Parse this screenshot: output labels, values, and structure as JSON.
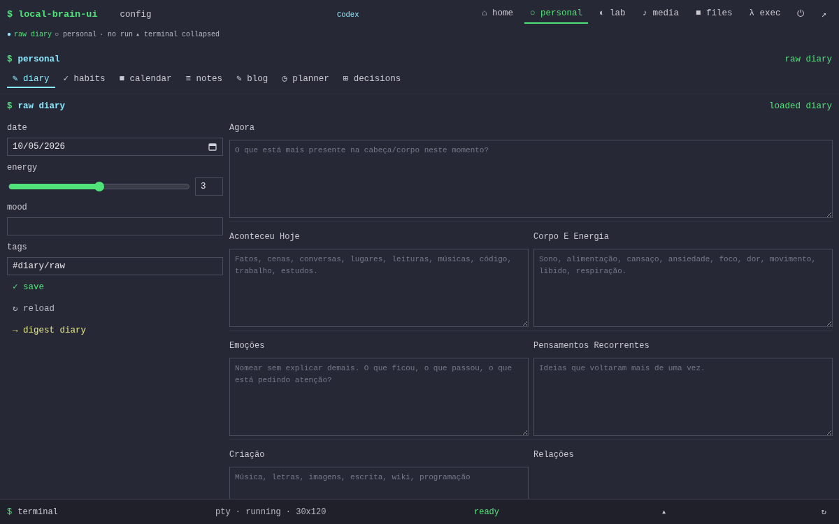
{
  "app": {
    "prompt": "$",
    "title": "local-brain-ui",
    "config": "config",
    "center": "Codex"
  },
  "nav": [
    {
      "label": "⌂ home",
      "selected": false
    },
    {
      "label": "○ personal",
      "selected": true
    },
    {
      "label": "◐ lab",
      "selected": false
    },
    {
      "label": "♪ media",
      "selected": false
    },
    {
      "label": "■ files",
      "selected": false
    },
    {
      "label": "λ exec",
      "selected": false
    }
  ],
  "nav_icons": [
    "⏻",
    "↗"
  ],
  "status": [
    {
      "text": "●",
      "kind": "dot"
    },
    {
      "text": "raw diary",
      "kind": "active"
    },
    {
      "text": "○ personal",
      "kind": "plain"
    },
    {
      "text": "· no run",
      "kind": "plain"
    },
    {
      "text": "▴ terminal collapsed",
      "kind": "plain"
    }
  ],
  "section": {
    "prompt": "$",
    "title": "personal",
    "right": "raw diary"
  },
  "tabs": [
    {
      "label": "✎ diary",
      "selected": true
    },
    {
      "label": "✓ habits",
      "selected": false
    },
    {
      "label": "■ calendar",
      "selected": false
    },
    {
      "label": "≡ notes",
      "selected": false
    },
    {
      "label": "✎ blog",
      "selected": false
    },
    {
      "label": "◷ planner",
      "selected": false
    },
    {
      "label": "⊞ decisions",
      "selected": false
    }
  ],
  "panel": {
    "prompt": "$",
    "title": "raw diary",
    "right": "loaded diary"
  },
  "form": {
    "date_label": "date",
    "date": "10/05/2026",
    "energy_label": "energy",
    "energy": {
      "level": 0.5,
      "value": "3"
    },
    "mood_label": "mood",
    "tags_label": "tags",
    "tags": "#diary/raw"
  },
  "actions": [
    {
      "label": "✓ save",
      "kind": "primary"
    },
    {
      "label": "↻ reload",
      "kind": "plain"
    },
    {
      "label": "→ digest diary",
      "kind": "accent"
    }
  ],
  "sections": [
    [
      {
        "label": "Agora",
        "placeholder": "O que está mais presente na cabeça/corpo neste momento?"
      }
    ],
    [
      {
        "label": "Aconteceu Hoje",
        "placeholder": "Fatos, cenas, conversas, lugares, leituras, músicas, código, trabalho, estudos."
      },
      {
        "label": "Corpo E Energia",
        "placeholder": "Sono, alimentação, cansaço, ansiedade, foco, dor, movimento, libido, respiração."
      }
    ],
    [
      {
        "label": "Emoções",
        "placeholder": "Nomear sem explicar demais. O que ficou, o que passou, o que está pedindo atenção?"
      },
      {
        "label": "Pensamentos Recorrentes",
        "placeholder": "Ideias que voltaram mais de uma vez."
      }
    ],
    [
      {
        "label": "Criação",
        "placeholder": "Música, letras, imagens, escrita, wiki, programação"
      },
      {
        "label": "Relações"
      }
    ]
  ],
  "terminal": {
    "prompt": "$",
    "title": "terminal",
    "info": "pty · running · 30x120",
    "state": "ready",
    "toggle": "▴",
    "refresh": "↻"
  }
}
